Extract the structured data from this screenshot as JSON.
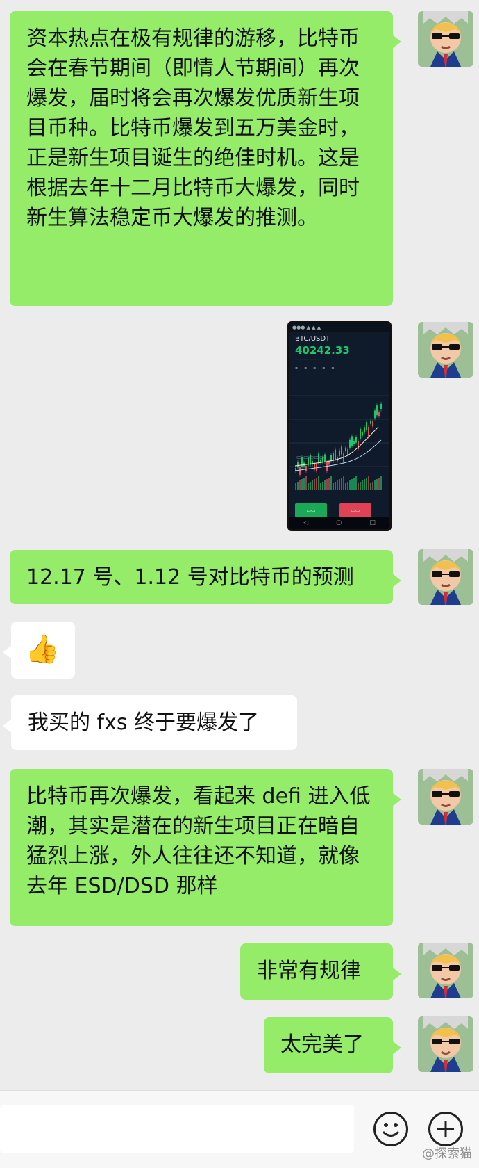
{
  "chat": {
    "messages": [
      {
        "side": "out",
        "text": "资本热点在极有规律的游移，比特币会在春节期间（即情人节期间）再次爆发，届时将会再次爆发优质新生项目币种。比特币爆发到五万美金时，正是新生项目诞生的绝佳时机。这是根据去年十二月比特币大爆发，同时新生算法稳定币大爆发的推测。"
      },
      {
        "side": "out",
        "type": "image",
        "screenshot": {
          "pair": "BTC/USDT",
          "price": "40242.33"
        }
      },
      {
        "side": "out",
        "text": "12.17 号、1.12 号对比特币的预测"
      },
      {
        "side": "in",
        "type": "emoji",
        "text": "👍"
      },
      {
        "side": "in",
        "text": "我买的 fxs 终于要爆发了"
      },
      {
        "side": "out",
        "text": "比特币再次爆发，看起来 defi 进入低潮，其实是潜在的新生项目正在暗自猛烈上涨，外人往往还不知道，就像去年 ESD/DSD 那样"
      },
      {
        "side": "out",
        "text": "非常有规律"
      },
      {
        "side": "out",
        "text": "太完美了"
      }
    ]
  },
  "input_bar": {
    "emoji_icon": "smiley-icon",
    "plus_icon": "plus-icon"
  },
  "watermark": "@探索猫",
  "colors": {
    "background": "#ececec",
    "outgoing_bubble": "#95ec69",
    "incoming_bubble": "#ffffff",
    "chart_up": "#1dc56b",
    "chart_down": "#e94a5b"
  }
}
